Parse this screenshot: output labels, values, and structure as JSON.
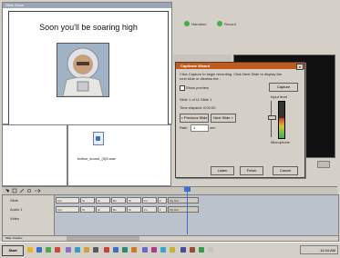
{
  "preview": {
    "window_title": "Slide Show",
    "slide_title": "Soon you'll be soaring high"
  },
  "file_panel": {
    "file_name": "button_sound_(3)5.wav"
  },
  "right_toolbar": {
    "button1": "Narration",
    "button2": "Record"
  },
  "dialog": {
    "title": "Captivate Wizard",
    "instructions_line1": "Click Capture to begin recording. Click Next Slide to display the",
    "instructions_line2": "next slide or dismiss the .",
    "checkbox_label": "Show preview",
    "capture_button": "Capture",
    "slide_info": "Slide 1 of 11 Slide 1",
    "time_elapsed": "Time elapsed: 0:00:00",
    "prev_slide_button": "< Previous Slide",
    "next_slide_button": "Next Slide >",
    "rate_label": "Rate",
    "rate_value": "1",
    "rate_unit": "min",
    "input_level_label": "Input level",
    "microphone_label": "Microphone",
    "meter_level": 0.55,
    "ok_button": "Listen",
    "finish_button": "Finish",
    "cancel_button": "Cancel"
  },
  "timeline": {
    "tracks": [
      {
        "label": "Slide",
        "cells": [
          "Cpt",
          "Te",
          "Hi",
          "Bu",
          "Sl",
          "Fu",
          "F",
          "Fly Out"
        ]
      },
      {
        "label": "Audio 1",
        "cells": [
          "Cpt",
          "Te",
          "Hi",
          "Bu",
          "Sl",
          "Fu",
          "F",
          "Fly Out"
        ]
      },
      {
        "label": "Video",
        "cells": []
      }
    ],
    "toolbar_label": "Slide Timeline"
  },
  "taskbar": {
    "start_label": "Start",
    "clock": "11:04 AM"
  },
  "colors": {
    "dialog_title": "#c25a1c",
    "playhead": "#3a6fd8",
    "meter_green": "#3bb24a"
  }
}
